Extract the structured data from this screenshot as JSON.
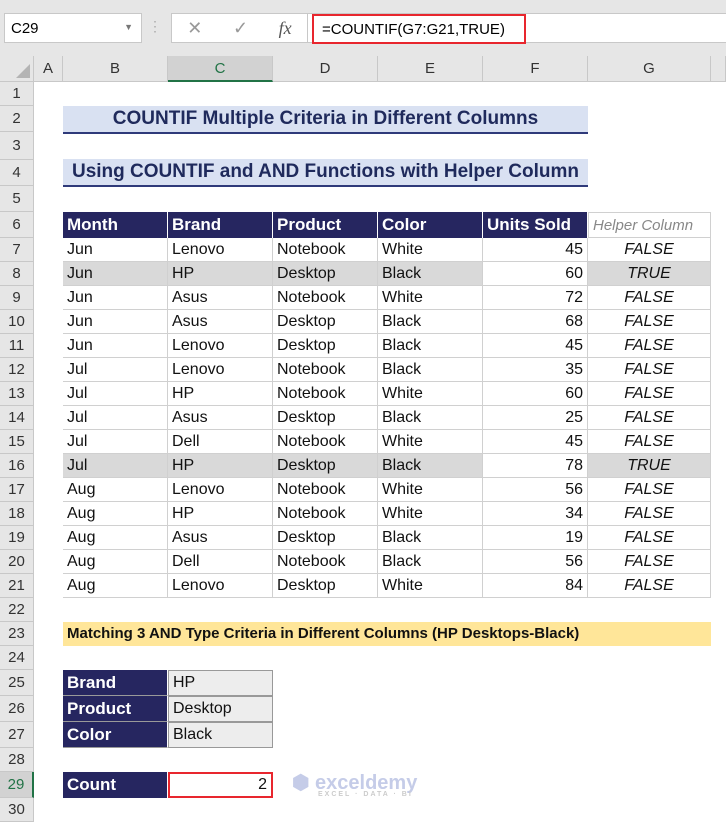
{
  "formula_bar": {
    "name_box": "C29",
    "formula": "=COUNTIF(G7:G21,TRUE)",
    "cancel": "✕",
    "enter": "✓",
    "fx": "fx"
  },
  "columns": [
    "A",
    "B",
    "C",
    "D",
    "E",
    "F",
    "G"
  ],
  "rows": [
    "1",
    "2",
    "3",
    "4",
    "5",
    "6",
    "7",
    "8",
    "9",
    "10",
    "11",
    "12",
    "13",
    "14",
    "15",
    "16",
    "17",
    "18",
    "19",
    "20",
    "21",
    "22",
    "23",
    "24",
    "25",
    "26",
    "27",
    "28",
    "29",
    "30"
  ],
  "title1": "COUNTIF Multiple Criteria in Different Columns",
  "title2": "Using COUNTIF and AND Functions with Helper Column",
  "table": {
    "headers": [
      "Month",
      "Brand",
      "Product",
      "Color",
      "Units Sold",
      "Helper Column"
    ],
    "rows": [
      [
        "Jun",
        "Lenovo",
        "Notebook",
        "White",
        "45",
        "FALSE"
      ],
      [
        "Jun",
        "HP",
        "Desktop",
        "Black",
        "60",
        "TRUE"
      ],
      [
        "Jun",
        "Asus",
        "Notebook",
        "White",
        "72",
        "FALSE"
      ],
      [
        "Jun",
        "Asus",
        "Desktop",
        "Black",
        "68",
        "FALSE"
      ],
      [
        "Jun",
        "Lenovo",
        "Desktop",
        "Black",
        "45",
        "FALSE"
      ],
      [
        "Jul",
        "Lenovo",
        "Notebook",
        "Black",
        "35",
        "FALSE"
      ],
      [
        "Jul",
        "HP",
        "Notebook",
        "White",
        "60",
        "FALSE"
      ],
      [
        "Jul",
        "Asus",
        "Desktop",
        "Black",
        "25",
        "FALSE"
      ],
      [
        "Jul",
        "Dell",
        "Notebook",
        "White",
        "45",
        "FALSE"
      ],
      [
        "Jul",
        "HP",
        "Desktop",
        "Black",
        "78",
        "TRUE"
      ],
      [
        "Aug",
        "Lenovo",
        "Notebook",
        "White",
        "56",
        "FALSE"
      ],
      [
        "Aug",
        "HP",
        "Notebook",
        "White",
        "34",
        "FALSE"
      ],
      [
        "Aug",
        "Asus",
        "Desktop",
        "Black",
        "19",
        "FALSE"
      ],
      [
        "Aug",
        "Dell",
        "Notebook",
        "Black",
        "56",
        "FALSE"
      ],
      [
        "Aug",
        "Lenovo",
        "Desktop",
        "White",
        "84",
        "FALSE"
      ]
    ]
  },
  "banner": "Matching 3 AND Type Criteria in Different Columns (HP Desktops-Black)",
  "criteria": [
    {
      "label": "Brand",
      "value": "HP"
    },
    {
      "label": "Product",
      "value": "Desktop"
    },
    {
      "label": "Color",
      "value": "Black"
    }
  ],
  "count": {
    "label": "Count",
    "value": "2"
  },
  "watermark": {
    "name": "exceldemy",
    "tagline": "EXCEL · DATA · BI"
  }
}
